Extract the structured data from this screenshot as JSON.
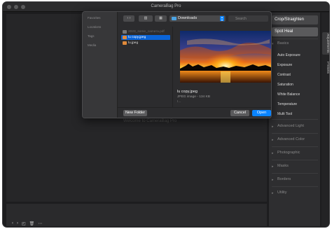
{
  "window": {
    "title": "CameraBag Pro"
  },
  "background_caption": "Welcome to CameraBag Pro",
  "dialog": {
    "sidebar": [
      "Favorites",
      "Locations",
      "Tags",
      "Media"
    ],
    "toolbar": {
      "back": "‹",
      "forward": "›",
      "location": "Downloads",
      "search_placeholder": "Search"
    },
    "files": [
      {
        "name": "2023_some_camera.pdf",
        "dimmed": true,
        "selected": false
      },
      {
        "name": "lu copy.jpeg",
        "dimmed": false,
        "selected": true
      },
      {
        "name": "lu.jpeg",
        "dimmed": false,
        "selected": false
      }
    ],
    "preview": {
      "name": "lu copy.jpeg",
      "meta": "JPEG image - 134 KB",
      "more": "I..."
    },
    "buttons": {
      "new_folder": "New Folder",
      "cancel": "Cancel",
      "open": "Open"
    }
  },
  "right_panel": {
    "crop_button": "Crop/Straighten",
    "spot_button": "Spot Heal",
    "sections": [
      {
        "label": "Basics",
        "expanded": true,
        "items": [
          "Auto Exposure",
          "Exposure",
          "Contrast",
          "Saturation",
          "White Balance",
          "Temperature",
          "Multi Tool"
        ]
      },
      {
        "label": "Advanced Light",
        "expanded": false
      },
      {
        "label": "Advanced Color",
        "expanded": false
      },
      {
        "label": "Photographic",
        "expanded": false
      },
      {
        "label": "Masks",
        "expanded": false
      },
      {
        "label": "Borders",
        "expanded": false
      },
      {
        "label": "Utility",
        "expanded": false
      }
    ],
    "tabs": [
      "Adjustments",
      "Presets"
    ]
  },
  "bottom_bar": {
    "icons": [
      "chevron-left-icon",
      "chevron-right-icon",
      "crop-icon",
      "trash-icon",
      "more-icon"
    ],
    "glyphs": [
      "‹",
      "›",
      "◰",
      "🗑",
      "⋯"
    ]
  },
  "colors": {
    "accent": "#0a84ff",
    "selection": "#0a64d8",
    "window_bg": "#1d1d1f"
  }
}
